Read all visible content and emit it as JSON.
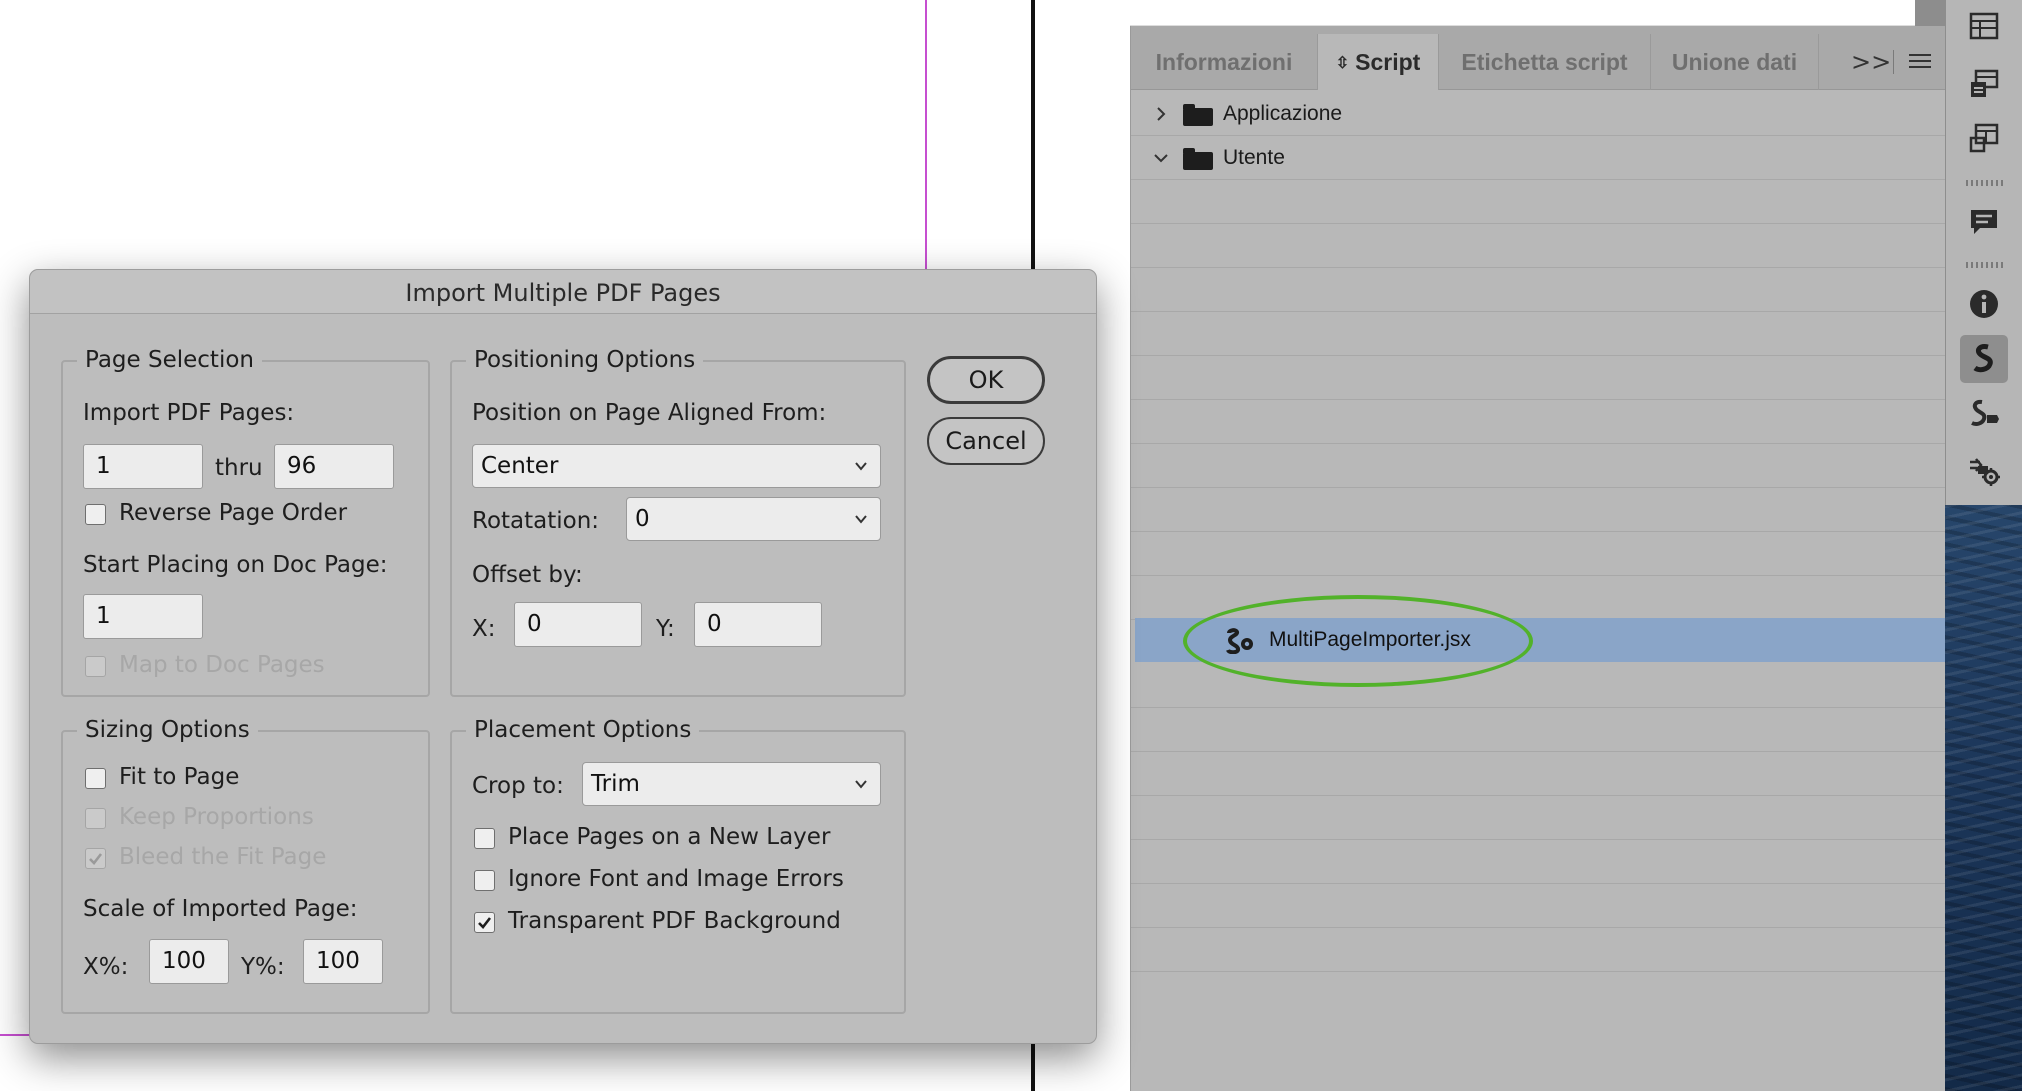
{
  "dialog": {
    "title": "Import Multiple PDF Pages",
    "page_selection": {
      "title": "Page Selection",
      "import_label": "Import PDF Pages:",
      "from": "1",
      "thru_label": "thru",
      "to": "96",
      "reverse_label": "Reverse Page Order",
      "reverse_checked": false,
      "start_label": "Start Placing on Doc Page:",
      "start_value": "1",
      "map_label": "Map to Doc Pages",
      "map_checked": false
    },
    "positioning": {
      "title": "Positioning Options",
      "aligned_label": "Position on Page Aligned From:",
      "aligned_value": "Center",
      "rotation_label": "Rotatation:",
      "rotation_value": "0",
      "offset_label": "Offset by:",
      "x_label": "X:",
      "x_value": "0",
      "y_label": "Y:",
      "y_value": "0"
    },
    "sizing": {
      "title": "Sizing Options",
      "fit_label": "Fit to Page",
      "fit_checked": false,
      "keep_label": "Keep Proportions",
      "keep_checked": false,
      "bleed_label": "Bleed the Fit Page",
      "bleed_checked": true,
      "scale_label": "Scale of Imported Page:",
      "xp_label": "X%:",
      "xp_value": "100",
      "yp_label": "Y%:",
      "yp_value": "100"
    },
    "placement": {
      "title": "Placement Options",
      "crop_label": "Crop to:",
      "crop_value": "Trim",
      "new_layer_label": "Place Pages on a New Layer",
      "new_layer_checked": false,
      "ignore_label": "Ignore Font and Image Errors",
      "ignore_checked": false,
      "transparent_label": "Transparent PDF Background",
      "transparent_checked": true
    },
    "ok_label": "OK",
    "cancel_label": "Cancel"
  },
  "script_panel": {
    "tabs": [
      {
        "label": "Informazioni",
        "active": false
      },
      {
        "label": "Script",
        "active": true
      },
      {
        "label": "Etichetta script",
        "active": false
      },
      {
        "label": "Unione dati",
        "active": false
      }
    ],
    "more_label": ">>",
    "folders": [
      {
        "label": "Applicazione",
        "expanded": false,
        "icon": "folder-icon"
      },
      {
        "label": "Utente",
        "expanded": true,
        "icon": "folder-icon"
      }
    ],
    "selected_script": {
      "label": "MultiPageImporter.jsx",
      "icon": "script-file-icon"
    }
  },
  "right_toolbar": {
    "icons": [
      "table-icon",
      "cell-styles-icon",
      "table-styles-icon",
      "comment-icon",
      "info-icon",
      "script-icon",
      "script-label-icon",
      "data-merge-icon"
    ],
    "active_icon": "script-icon"
  },
  "colors": {
    "selection": "#8aa5c8",
    "highlight_ellipse": "#52b22a",
    "guide": "#c64fd0"
  }
}
